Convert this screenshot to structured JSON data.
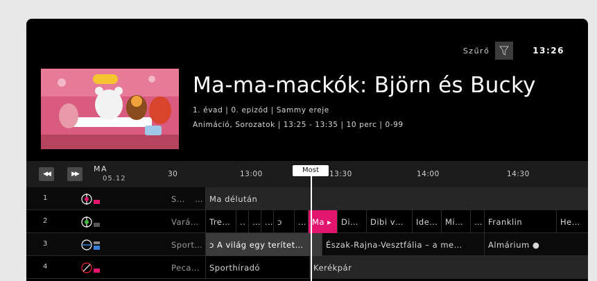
{
  "header": {
    "filter_label": "Szűrő",
    "clock": "13:26",
    "filter_icon": "funnel-icon"
  },
  "program": {
    "title": "Ma-ma-mackók: Björn és Bucky",
    "meta_line1": "1. évad | 0. epizód | Sammy ereje",
    "meta_line2": "Animáció, Sorozatok | 13:25 - 13:35 | 10 perc | 0-99"
  },
  "timeline": {
    "day": "MA",
    "date": "05.12",
    "ticks": [
      "30",
      "13:00",
      "13:30",
      "14:00",
      "14:30"
    ],
    "now_label": "Most",
    "rewind_icon": "rewind-icon",
    "forward_icon": "fast-forward-icon"
  },
  "rows": [
    {
      "num": "1",
      "cells": [
        {
          "t": "S…"
        },
        {
          "t": "…"
        },
        {
          "t": "Ma délután"
        }
      ]
    },
    {
      "num": "2",
      "cells": [
        {
          "t": "Vará…"
        },
        {
          "t": "Tre…"
        },
        {
          "t": ".."
        },
        {
          "t": "…"
        },
        {
          "t": "…"
        },
        {
          "t": "ↄ"
        },
        {
          "t": "…"
        },
        {
          "t": "Ma ▸"
        },
        {
          "t": "Di…"
        },
        {
          "t": "Dibi v…"
        },
        {
          "t": "Ide…"
        },
        {
          "t": "Mi…"
        },
        {
          "t": "…"
        },
        {
          "t": "Franklin"
        },
        {
          "t": "He…"
        }
      ]
    },
    {
      "num": "3",
      "cells": [
        {
          "t": "Sport…"
        },
        {
          "t": "ↄ A világ egy terítet…"
        },
        {
          "t": "Észak-Rajna-Vesztfália – a me…"
        },
        {
          "t": "Almárium ●"
        }
      ]
    },
    {
      "num": "4",
      "cells": [
        {
          "t": "Peca…"
        },
        {
          "t": "Sporthíradó"
        },
        {
          "t": "Kerékpár"
        }
      ]
    }
  ]
}
